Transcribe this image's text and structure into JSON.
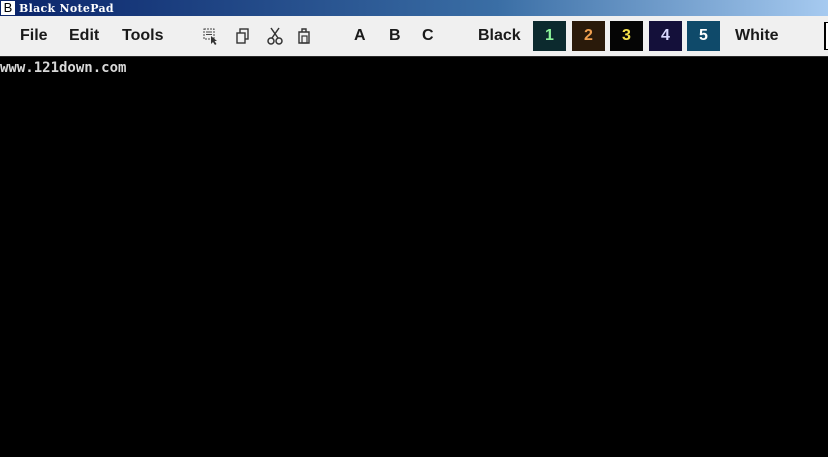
{
  "window": {
    "title": "Black NotePad",
    "app_icon_glyph": "B"
  },
  "menu": {
    "file": "File",
    "edit": "Edit",
    "tools": "Tools"
  },
  "toolbar_icons": [
    "select-all-icon",
    "copy-icon",
    "cut-icon",
    "paste-icon"
  ],
  "fonts": {
    "a": "A",
    "b": "B",
    "c": "C"
  },
  "themes": {
    "black_label": "Black",
    "white_label": "White",
    "swatches": [
      {
        "label": "1",
        "bg": "#0c2a2e",
        "fg": "#8cf59a"
      },
      {
        "label": "2",
        "bg": "#2a1a0a",
        "fg": "#f0a050"
      },
      {
        "label": "3",
        "bg": "#050505",
        "fg": "#f4e04a"
      },
      {
        "label": "4",
        "bg": "#14103a",
        "fg": "#d8d8ff"
      },
      {
        "label": "5",
        "bg": "#0f4a6a",
        "fg": "#ffffff"
      }
    ]
  },
  "editor": {
    "content": "www.121down.com",
    "background": "#000000",
    "text_color": "#d8d8d8"
  }
}
